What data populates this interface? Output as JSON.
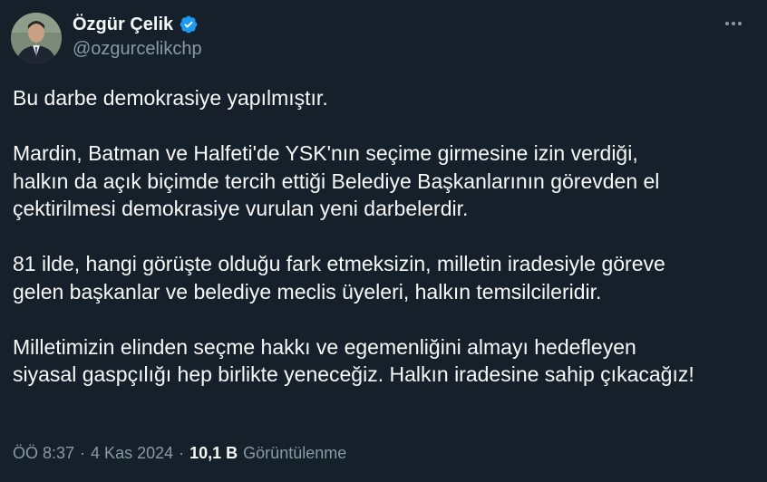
{
  "author": {
    "name": "Özgür Çelik",
    "handle": "@ozgurcelikchp",
    "verified": true,
    "avatar_icon": "profile-photo"
  },
  "more_icon": "more-options-icon",
  "tweet": {
    "paragraphs": [
      "Bu darbe demokrasiye yapılmıştır.",
      "Mardin, Batman ve Halfeti'de YSK'nın seçime girmesine izin verdiği,\nhalkın da açık biçimde tercih ettiği Belediye Başkanlarının görevden el\nçektirilmesi demokrasiye vurulan yeni darbelerdir.",
      "81 ilde, hangi görüşte olduğu fark etmeksizin, milletin iradesiyle göreve\ngelen başkanlar ve belediye meclis üyeleri, halkın temsilcileridir.",
      "Milletimizin elinden seçme hakkı ve egemenliğini almayı hedefleyen\nsiyasal gaspçılığı hep birlikte yeneceğiz. Halkın iradesine sahip çıkacağız!"
    ]
  },
  "meta": {
    "time": "ÖÖ 8:37",
    "sep1": "·",
    "date": "4 Kas 2024",
    "sep2": "·",
    "views_count": "10,1 B",
    "views_label": "Görüntülenme"
  },
  "colors": {
    "background": "#15202b",
    "text": "#f7f9f9",
    "secondary": "#8b98a5",
    "verified": "#1d9bf0"
  }
}
